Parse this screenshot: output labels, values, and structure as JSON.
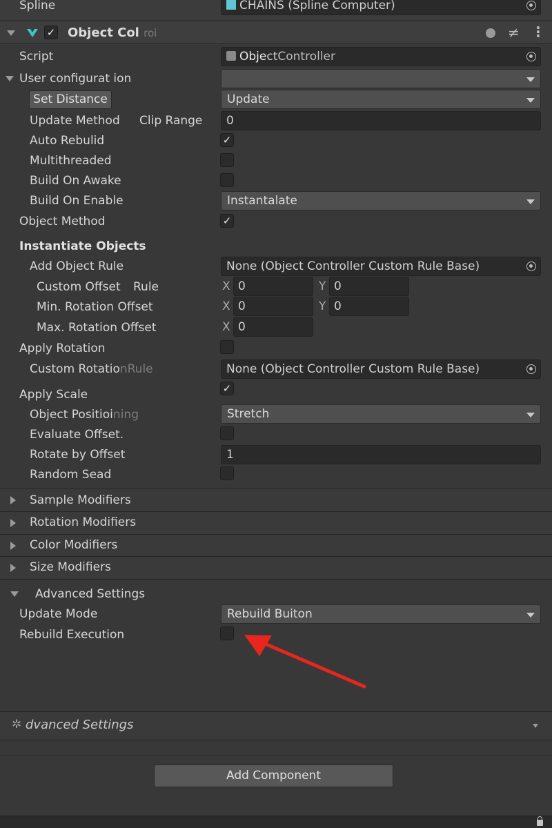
{
  "top_row": {
    "label": "Spline",
    "value": "CHAINS (Spline Computer)"
  },
  "component": {
    "title": "Object Col",
    "title_faint": "roi"
  },
  "script": {
    "label": "Script",
    "value_bold": "Obje",
    "value_mid": "ct",
    "value_rest": "Controller"
  },
  "user_config": {
    "label_a": "User configurat",
    "label_b": " ion"
  },
  "set_distance": {
    "button": "Set Distance",
    "value": "Update"
  },
  "update_method": {
    "label": "Update Method",
    "sub_label": "Clip Range",
    "value": "0"
  },
  "auto_rebuild": {
    "label": "Auto Rebulid",
    "checked": true
  },
  "multithreaded": {
    "label": "Multithreaded",
    "checked": false
  },
  "build_on_awake": {
    "label": "Build On Awake",
    "checked": false
  },
  "build_on_enable": {
    "label": "Build On Enable",
    "value": "Instantalate"
  },
  "object_method": {
    "label": "Object Method",
    "checked": true
  },
  "instantiate_header": "Instantiate Objects",
  "add_object_rule": {
    "label": "Add Object Rule",
    "value": "None (Object Controller Custom Rule Base)"
  },
  "custom_offset": {
    "label": "Custom Offset",
    "sub_label": "Rule",
    "x_label": "X",
    "x": "0",
    "y_label": "Y",
    "y": "0"
  },
  "min_rotation": {
    "label": "Min. Rotation Offset",
    "x_label": "X",
    "x": "0",
    "y_label": "Y",
    "y": "0"
  },
  "max_rotation": {
    "label": "Max. Rotation Offset",
    "x_label": "X",
    "x": "0"
  },
  "apply_rotation": {
    "label": "Apply Rotation",
    "checked": false
  },
  "custom_rotation_rule": {
    "label_a": "Custom Rotatio",
    "label_b": "nRule",
    "value": "None (Object Controller Custom Rule Base)"
  },
  "apply_scale": {
    "label": "Apply Scale",
    "checked": true
  },
  "object_positioning": {
    "label_a": "Object Positioi",
    "label_b": "ning",
    "value": "Stretch"
  },
  "evaluate_offset": {
    "label": "Evaluate Offset.",
    "checked": false
  },
  "rotate_by_offset": {
    "label": "Rotate by Offset",
    "value": "1"
  },
  "random_seed": {
    "label": "Random Sead",
    "checked": false
  },
  "foldouts": [
    "Sample Modifiers",
    "Rotation Modifiers",
    "Color Modifiers",
    "Size Modifiers"
  ],
  "advanced": {
    "label": "Advanced Settings"
  },
  "update_mode": {
    "label": "Update Mode",
    "value": "Rebuild Buiton"
  },
  "rebuild_execution": {
    "label": "Rebuild Execution",
    "checked": false
  },
  "advanced_collapsed": {
    "label": "dvanced Settings"
  },
  "add_component": "Add Component",
  "check_glyph": "✓",
  "colors": {
    "background": "#383838",
    "field": "#2a2a2a",
    "dropdown": "#4f4f4f",
    "arrow": "#e8261e",
    "accent": "#3fc3cf"
  }
}
